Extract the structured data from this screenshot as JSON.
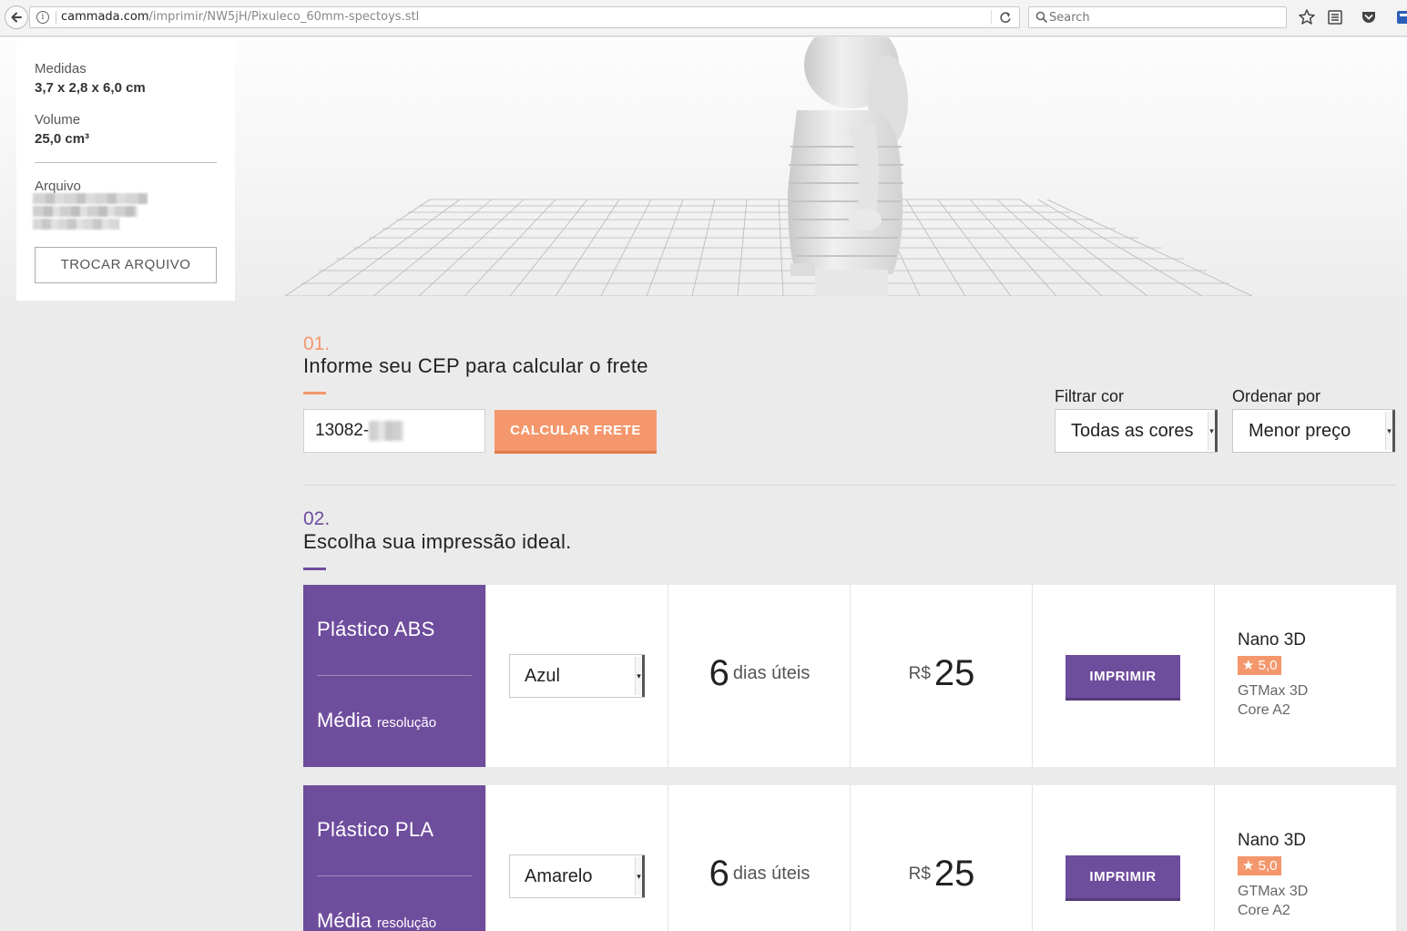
{
  "browser": {
    "url_host": "cammada.com",
    "url_path": "/imprimir/NW5jH/Pixuleco_60mm-spectoys.stl",
    "search_placeholder": "Search"
  },
  "model_info": {
    "medidas_label": "Medidas",
    "medidas_value": "3,7 x 2,8 x 6,0 cm",
    "volume_label": "Volume",
    "volume_value": "25,0 cm³",
    "arquivo_label": "Arquivo",
    "trocar_button": "TROCAR ARQUIVO"
  },
  "step1": {
    "number": "01.",
    "title": "Informe seu CEP para calcular o frete",
    "cep_value": "13082-",
    "calc_button": "CALCULAR FRETE",
    "filter_label": "Filtrar cor",
    "filter_value": "Todas as cores",
    "sort_label": "Ordenar por",
    "sort_value": "Menor preço"
  },
  "step2": {
    "number": "02.",
    "title": "Escolha sua impressão ideal."
  },
  "options": [
    {
      "material": "Plástico ABS",
      "resolution": "Média",
      "resolution_suffix": "resolução",
      "color": "Azul",
      "days": "6",
      "days_label": "dias úteis",
      "currency": "R$",
      "price": "25",
      "print_button": "IMPRIMIR",
      "printer_name": "Nano 3D",
      "rating": "★ 5,0",
      "printer_model_1": "GTMax 3D",
      "printer_model_2": "Core A2"
    },
    {
      "material": "Plástico PLA",
      "resolution": "Média",
      "resolution_suffix": "resolução",
      "color": "Amarelo",
      "days": "6",
      "days_label": "dias úteis",
      "currency": "R$",
      "price": "25",
      "print_button": "IMPRIMIR",
      "printer_name": "Nano 3D",
      "rating": "★ 5,0",
      "printer_model_1": "GTMax 3D",
      "printer_model_2": "Core A2"
    }
  ],
  "colors": {
    "accent_orange": "#f4976c",
    "accent_purple": "#6f4d9d",
    "background": "#ebebeb"
  },
  "icons": {
    "back": "arrow-left-icon",
    "info": "info-icon",
    "reload": "reload-icon",
    "search": "search-icon",
    "bookmark": "star-icon",
    "reading_list": "reading-list-icon",
    "pocket": "pocket-icon",
    "rating": "star-icon"
  }
}
